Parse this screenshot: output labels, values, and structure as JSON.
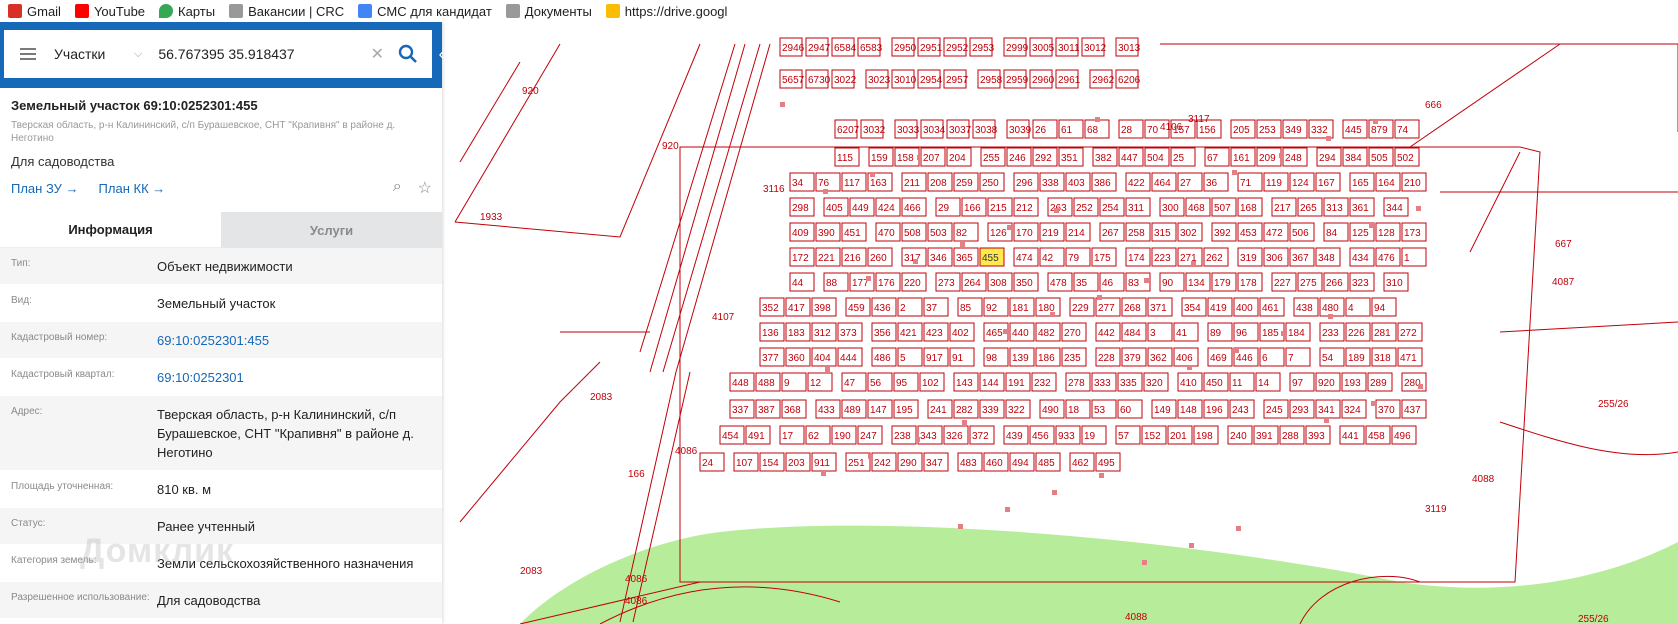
{
  "bookmarks": [
    {
      "label": "Gmail",
      "icon": "gmail-icon",
      "color": "#d93025"
    },
    {
      "label": "YouTube",
      "icon": "youtube-icon",
      "color": "#ff0000"
    },
    {
      "label": "Карты",
      "icon": "maps-pin-icon",
      "color": "#34a853"
    },
    {
      "label": "Вакансии | CRC",
      "icon": "page-icon",
      "color": "#999999"
    },
    {
      "label": "СМС для кандидат",
      "icon": "docs-icon",
      "color": "#4285f4"
    },
    {
      "label": "Документы",
      "icon": "folder-icon",
      "color": "#999999"
    },
    {
      "label": "https://drive.googl",
      "icon": "drive-icon",
      "color": "#fbbc04"
    }
  ],
  "search": {
    "layer": "Участки",
    "query": "56.767395 35.918437"
  },
  "object": {
    "title": "Земельный участок 69:10:0252301:455",
    "address": "Тверская область, р-н Калининский, с/п Бурашевское, СНТ \"Крапивня\" в районе д. Неготино",
    "purpose": "Для садоводства",
    "plan_zu": "План ЗУ",
    "plan_kk": "План КК"
  },
  "tabs": {
    "info": "Информация",
    "services": "Услуги"
  },
  "fields": [
    {
      "key": "Тип:",
      "value": "Объект недвижимости",
      "link": false
    },
    {
      "key": "Вид:",
      "value": "Земельный участок",
      "link": false
    },
    {
      "key": "Кадастровый номер:",
      "value": "69:10:0252301:455",
      "link": true
    },
    {
      "key": "Кадастровый квартал:",
      "value": "69:10:0252301",
      "link": true
    },
    {
      "key": "Адрес:",
      "value": "Тверская область, р-н Калининский, с/п Бурашевское, СНТ \"Крапивня\" в районе д. Неготино",
      "link": false
    },
    {
      "key": "Площадь уточненная:",
      "value": "810 кв. м",
      "link": false
    },
    {
      "key": "Статус:",
      "value": "Ранее учтенный",
      "link": false
    },
    {
      "key": "Категория земель:",
      "value": "Земли сельскохозяйственного назначения",
      "link": false
    },
    {
      "key": "Разрешенное использование:",
      "value": "Для садоводства",
      "link": false
    }
  ],
  "watermark": "Домклик",
  "colors": {
    "accent": "#1668b8",
    "plot": "#c0000a",
    "selected": "#ffe94d",
    "green": "#b7ec9a"
  },
  "map_labels": [
    "920",
    "920",
    "1933",
    "666",
    "667",
    "4087",
    "4107",
    "2083",
    "4086",
    "2083",
    "4086",
    "4086",
    "4088",
    "255/26",
    "255/26",
    "3117",
    "4106",
    "3116",
    "3119",
    "166",
    "4088"
  ],
  "plots": [
    "2946",
    "2947",
    "6584",
    "6583",
    "2950",
    "2951",
    "2952",
    "2953",
    "2999",
    "3005",
    "3011",
    "3012",
    "3013",
    "5657",
    "6730",
    "3022",
    "3023",
    "3010",
    "2954",
    "2957",
    "2958",
    "2959",
    "2960",
    "2961",
    "2962",
    "6206",
    "6207",
    "3032",
    "3033",
    "3034",
    "3037",
    "3038",
    "3039",
    "26",
    "61",
    "68",
    "28",
    "70",
    "157",
    "156",
    "205",
    "253",
    "349",
    "332",
    "445",
    "879",
    "74",
    "115",
    "159",
    "158",
    "207",
    "204",
    "255",
    "246",
    "292",
    "351",
    "382",
    "447",
    "504",
    "25",
    "67",
    "161",
    "209",
    "248",
    "294",
    "384",
    "505",
    "502",
    "34",
    "76",
    "117",
    "163",
    "211",
    "208",
    "259",
    "250",
    "296",
    "338",
    "403",
    "386",
    "422",
    "464",
    "27",
    "36",
    "71",
    "119",
    "124",
    "167",
    "165",
    "164",
    "210",
    "298",
    "405",
    "449",
    "424",
    "466",
    "29",
    "166",
    "215",
    "212",
    "263",
    "252",
    "254",
    "311",
    "300",
    "468",
    "507",
    "168",
    "217",
    "265",
    "313",
    "361",
    "344",
    "409",
    "390",
    "451",
    "470",
    "508",
    "503",
    "82",
    "126",
    "170",
    "219",
    "214",
    "267",
    "258",
    "315",
    "302",
    "392",
    "453",
    "472",
    "506",
    "84",
    "125",
    "128",
    "173",
    "172",
    "221",
    "216",
    "260",
    "317",
    "346",
    "365",
    "455",
    "474",
    "42",
    "79",
    "175",
    "174",
    "223",
    "271",
    "262",
    "319",
    "306",
    "367",
    "348",
    "434",
    "476",
    "1",
    "44",
    "88",
    "177",
    "176",
    "220",
    "273",
    "264",
    "308",
    "350",
    "478",
    "35",
    "46",
    "83",
    "90",
    "134",
    "179",
    "178",
    "227",
    "275",
    "266",
    "323",
    "310",
    "352",
    "417",
    "398",
    "459",
    "436",
    "2",
    "37",
    "85",
    "92",
    "181",
    "180",
    "229",
    "277",
    "268",
    "371",
    "354",
    "419",
    "400",
    "461",
    "438",
    "480",
    "4",
    "94",
    "136",
    "183",
    "312",
    "373",
    "356",
    "421",
    "423",
    "402",
    "465",
    "440",
    "482",
    "270",
    "442",
    "484",
    "3",
    "41",
    "89",
    "96",
    "185",
    "184",
    "233",
    "226",
    "281",
    "272",
    "377",
    "360",
    "404",
    "444",
    "486",
    "5",
    "917",
    "91",
    "98",
    "139",
    "186",
    "235",
    "228",
    "379",
    "362",
    "406",
    "469",
    "446",
    "6",
    "7",
    "54",
    "189",
    "318",
    "471",
    "448",
    "488",
    "9",
    "12",
    "47",
    "56",
    "95",
    "102",
    "143",
    "144",
    "191",
    "232",
    "278",
    "333",
    "335",
    "320",
    "410",
    "450",
    "11",
    "14",
    "97",
    "920",
    "193",
    "289",
    "280",
    "337",
    "387",
    "368",
    "433",
    "489",
    "147",
    "195",
    "241",
    "282",
    "339",
    "322",
    "490",
    "18",
    "53",
    "60",
    "149",
    "148",
    "196",
    "243",
    "245",
    "293",
    "341",
    "324",
    "370",
    "437",
    "454",
    "491",
    "17",
    "62",
    "190",
    "247",
    "238",
    "343",
    "326",
    "372",
    "439",
    "456",
    "933",
    "19",
    "57",
    "152",
    "201",
    "198",
    "240",
    "391",
    "288",
    "393",
    "441",
    "458",
    "496",
    "24",
    "107",
    "154",
    "203",
    "911",
    "251",
    "242",
    "290",
    "347",
    "483",
    "460",
    "494",
    "485",
    "462",
    "495"
  ]
}
